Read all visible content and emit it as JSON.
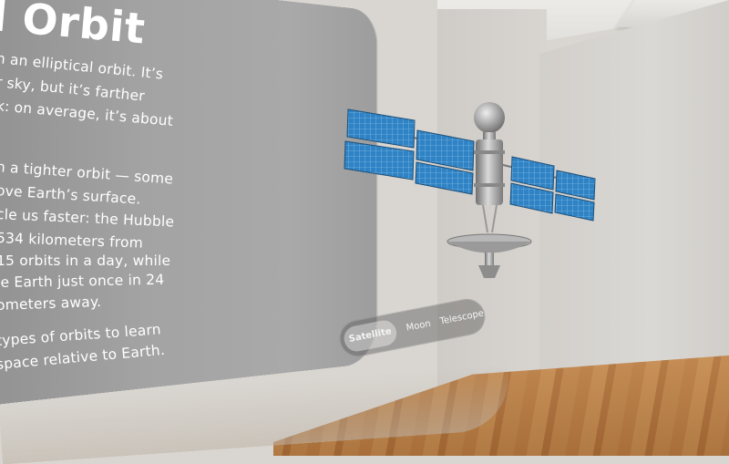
{
  "panel": {
    "title": "l Orbit",
    "paragraphs": [
      [
        "n an elliptical orbit. It’s",
        "r sky, but it’s farther",
        "k: on average, it’s about"
      ],
      [
        "n a tighter orbit — some",
        "ove Earth’s surface.",
        "cle us faster: the Hubble",
        "534 kilometers from",
        "15 orbits in a day, while",
        "le Earth just once in 24",
        "ometers away."
      ],
      [
        "types of orbits to learn",
        "space relative to Earth."
      ]
    ]
  },
  "model": {
    "name": "satellite-model",
    "icon": "satellite-icon"
  },
  "segmented_control": {
    "selected": "Satellite",
    "items": [
      {
        "label": "Satellite"
      },
      {
        "label": "Moon"
      },
      {
        "label": "Telescope"
      }
    ]
  },
  "colors": {
    "panel_glass": "#a3a3a3",
    "text": "#ffffff",
    "solar_panel": "#2d7fbf",
    "floor": "#b5773e"
  }
}
